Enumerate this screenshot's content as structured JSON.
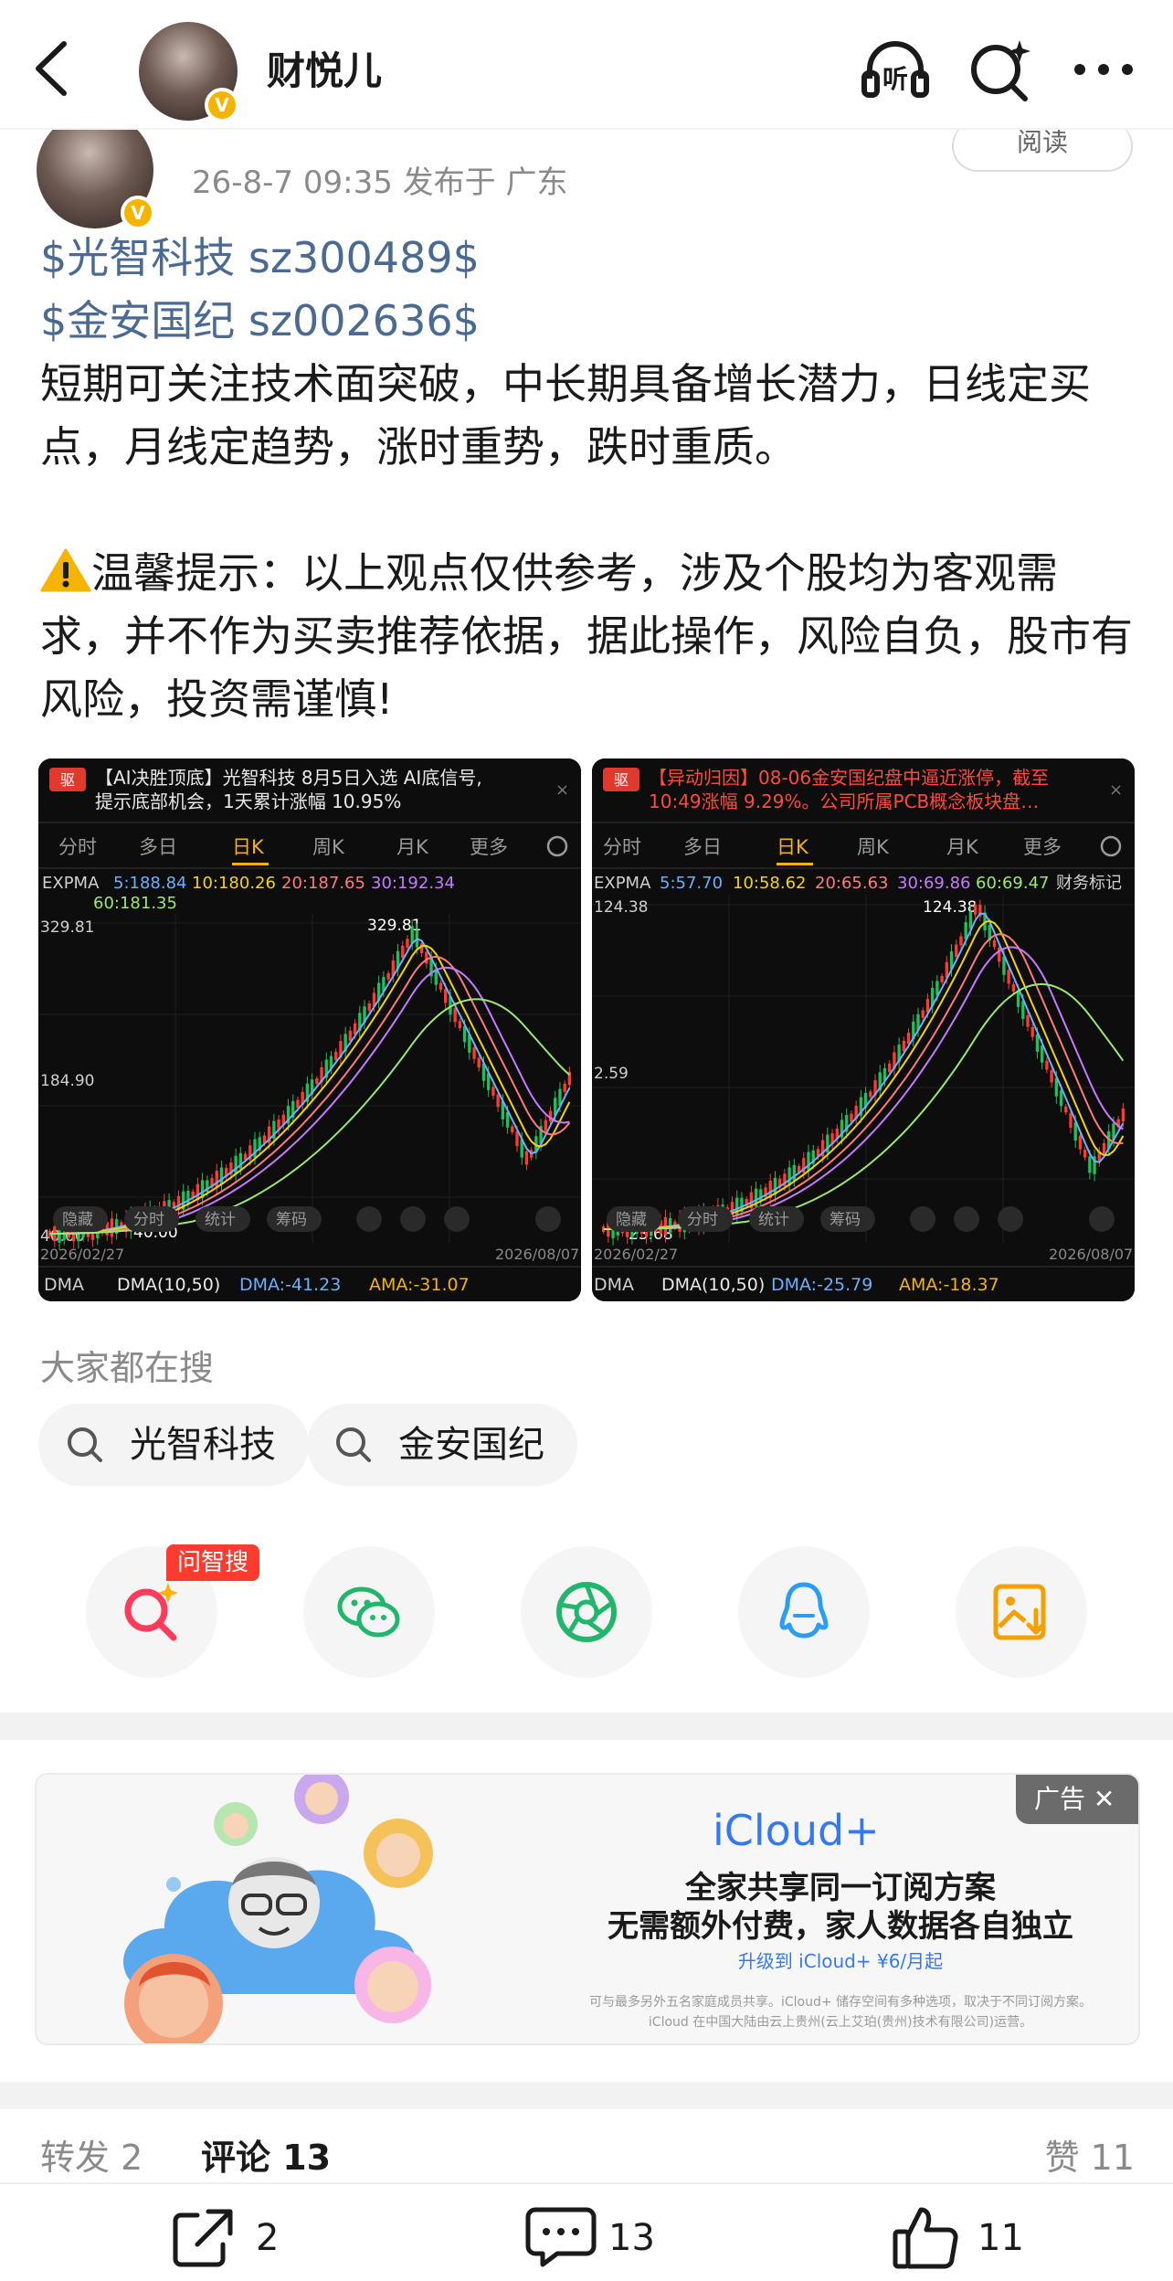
{
  "topbar": {
    "user_name": "财悦儿",
    "verified_badge": "V",
    "icons": [
      "back-icon",
      "listen-icon",
      "search-sparkle-icon",
      "more-icon"
    ],
    "listen_label": "听"
  },
  "meta": {
    "time_location": "26-8-7 09:35  发布于 广东",
    "read_label": "阅读"
  },
  "post": {
    "stock_link_1": "$光智科技 sz300489$",
    "stock_link_2": "$金安国纪 sz002636$",
    "paragraph_1": "短期可关注技术面突破，中长期具备增长潜力，日线定买点，月线定趋势，涨时重势，跌时重质。",
    "paragraph_2": "温馨提示：以上观点仅供参考，涉及个股均为客观需求，并不作为买卖推荐依据，据此操作，风险自负，股市有风险，投资需谨慎!"
  },
  "charts": [
    {
      "logo": "驱",
      "banner_1": "【AI决胜顶底】光智科技 8月5日入选 AI底信号,",
      "banner_2": "提示底部机会，1天累计涨幅 10.95%",
      "tabs": [
        "分时",
        "多日",
        "日K",
        "周K",
        "月K",
        "更多"
      ],
      "active_tab": "日K",
      "expma_label": "EXPMA",
      "ma": [
        "5:188.84",
        "10:180.26",
        "20:187.65",
        "30:192.34",
        "60:181.35"
      ],
      "peak_label": "329.81",
      "y_top": "329.81",
      "y_mid": "184.90",
      "y_low": "40.00",
      "low_label": "40.00",
      "date_start": "2026/02/27",
      "date_end": "2026/08/07",
      "controls": [
        "隐藏",
        "分时",
        "统计",
        "筹码"
      ],
      "dma_name": "DMA",
      "dma_params": "DMA(10,50)",
      "dma_value": "DMA:-41.23",
      "ama_value": "AMA:-31.07"
    },
    {
      "logo": "驱",
      "banner_1": "【异动归因】08-06金安国纪盘中逼近涨停，截至",
      "banner_2": "10:49涨幅 9.29%。公司所属PCB概念板块盘…",
      "tabs": [
        "分时",
        "多日",
        "日K",
        "周K",
        "月K",
        "更多"
      ],
      "active_tab": "日K",
      "expma_label": "EXPMA",
      "ma": [
        "5:57.70",
        "10:58.62",
        "20:65.63",
        "30:69.86",
        "60:69.47"
      ],
      "extra": "财务标记",
      "peak_label": "124.38",
      "y_top": "124.38",
      "y_mid": "2.59",
      "y_low": "",
      "low_label": "23.68",
      "date_start": "2026/02/27",
      "date_end": "2026/08/07",
      "controls": [
        "隐藏",
        "分时",
        "统计",
        "筹码"
      ],
      "dma_name": "DMA",
      "dma_params": "DMA(10,50)",
      "dma_value": "DMA:-25.79",
      "ama_value": "AMA:-18.37"
    }
  ],
  "search": {
    "title": "大家都在搜",
    "chips": [
      "光智科技",
      "金安国纪"
    ]
  },
  "share": {
    "badge": "问智搜",
    "buttons": [
      "ai-search-icon",
      "wechat-icon",
      "moments-icon",
      "qq-icon",
      "save-image-icon"
    ]
  },
  "ad": {
    "tag": "广告",
    "title": "iCloud+",
    "line_1": "全家共享同一订阅方案",
    "line_2": "无需额外付费，家人数据各自独立",
    "cta": "升级到 iCloud+ ¥6/月起",
    "fine_1": "可与最多另外五名家庭成员共享。iCloud+ 储存空间有多种选项，取决于不同订阅方案。",
    "fine_2": "iCloud 在中国大陆由云上贵州(云上艾珀(贵州)技术有限公司)运营。"
  },
  "tabs": {
    "repost": "转发 2",
    "comments": "评论 13",
    "likes": "赞 11"
  },
  "bottombar": {
    "repost_count": "2",
    "comment_count": "13",
    "like_count": "11"
  }
}
